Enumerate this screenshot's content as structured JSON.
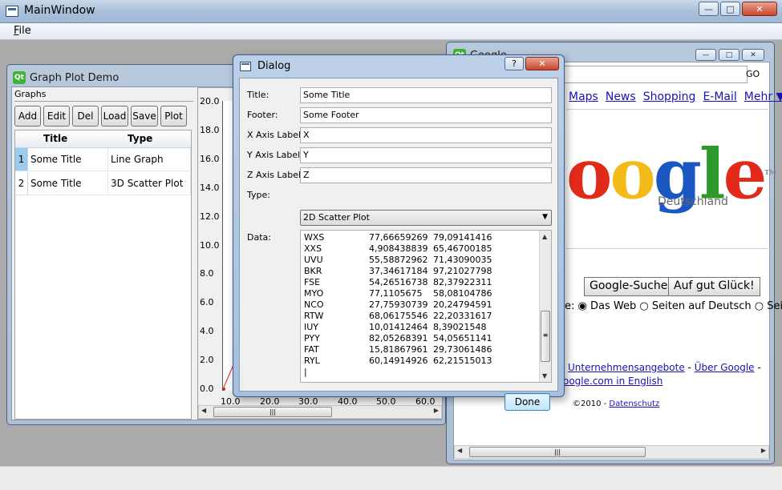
{
  "main_window": {
    "title": "MainWindow",
    "min_glyph": "—",
    "max_glyph": "□",
    "close_glyph": "✕",
    "menu": {
      "file_first": "F",
      "file_rest": "ile"
    }
  },
  "graph_demo": {
    "icon_text": "Qt",
    "title": "Graph Plot Demo",
    "group_label": "Graphs",
    "buttons": [
      "Add",
      "Edit",
      "Del",
      "Load",
      "Save",
      "Plot"
    ],
    "table": {
      "headers": [
        "Title",
        "Type"
      ],
      "rows": [
        {
          "num": "1",
          "title": "Some Title",
          "type": "Line Graph"
        },
        {
          "num": "2",
          "title": "Some Title",
          "type": "3D Scatter Plot"
        }
      ]
    },
    "plot": {
      "y_ticks": [
        "20.0",
        "18.0",
        "16.0",
        "14.0",
        "12.0",
        "10.0",
        "8.0",
        "6.0",
        "4.0",
        "2.0",
        "0.0"
      ],
      "x_ticks": [
        "10.0",
        "20.0",
        "30.0",
        "40.0",
        "50.0",
        "60.0"
      ],
      "scroll_grip": "|||",
      "line_color": "#e02020"
    }
  },
  "google": {
    "icon_text": "Qt",
    "title": "Google",
    "go_label": "GO",
    "links": [
      "Maps",
      "News",
      "Shopping",
      "E-Mail",
      "Mehr ▼",
      "i"
    ],
    "logo_letters": [
      "o",
      "o",
      "g",
      "l",
      "e"
    ],
    "logo_colors": [
      "#e22a1b",
      "#f3bb17",
      "#1b57c2",
      "#2b9a2a",
      "#e22a1b"
    ],
    "logo_tm": "TM",
    "subtitle": "Deutschland",
    "search_button": "Google-Suche",
    "lucky_button": "Auf gut Glück!",
    "radio_prefix": "e:",
    "radio_web": "Das Web",
    "radio_de": "Seiten auf Deutsch",
    "radio_cut": "Sei",
    "line1": "Unternehmensangebote",
    "line1_sep": " - ",
    "line1_b": "Über Google",
    "line1_end": " -",
    "line2": "oogle.com in English",
    "footer_copy": "©2010 - ",
    "footer_link": "Datenschutz",
    "scroll_grip": "|||"
  },
  "dialog": {
    "title": "Dialog",
    "help_glyph": "?",
    "close_glyph": "✕",
    "labels": {
      "title": "Title:",
      "footer": "Footer:",
      "x_axis": "X Axis Label:",
      "y_axis": "Y Axis Label:",
      "z_axis": "Z Axis Label:",
      "type": "Type:",
      "data": "Data:"
    },
    "values": {
      "title": "Some Title",
      "footer": "Some Footer",
      "x_axis": "X",
      "y_axis": "Y",
      "z_axis": "Z",
      "type": "2D Scatter Plot"
    },
    "data_rows": [
      [
        "WXS",
        "77,66659269",
        "79,09141416"
      ],
      [
        "XXS",
        "4,908438839",
        "65,46700185"
      ],
      [
        "UVU",
        "55,58872962",
        "71,43090035"
      ],
      [
        "BKR",
        "37,34617184",
        "97,21027798"
      ],
      [
        "FSE",
        "54,26516738",
        "82,37922311"
      ],
      [
        "MYO",
        "77,1105675",
        "58,08104786"
      ],
      [
        "NCO",
        "27,75930739",
        "20,24794591"
      ],
      [
        "RTW",
        "68,06175546",
        "22,20331617"
      ],
      [
        "IUY",
        "10,01412464",
        "8,39021548"
      ],
      [
        "PYY",
        "82,05268391",
        "54,05651141"
      ],
      [
        "FAT",
        "15,81867961",
        "29,73061486"
      ],
      [
        "RYL",
        "60,14914926",
        "62,21515013"
      ]
    ],
    "caret": "|",
    "done": "Done"
  }
}
